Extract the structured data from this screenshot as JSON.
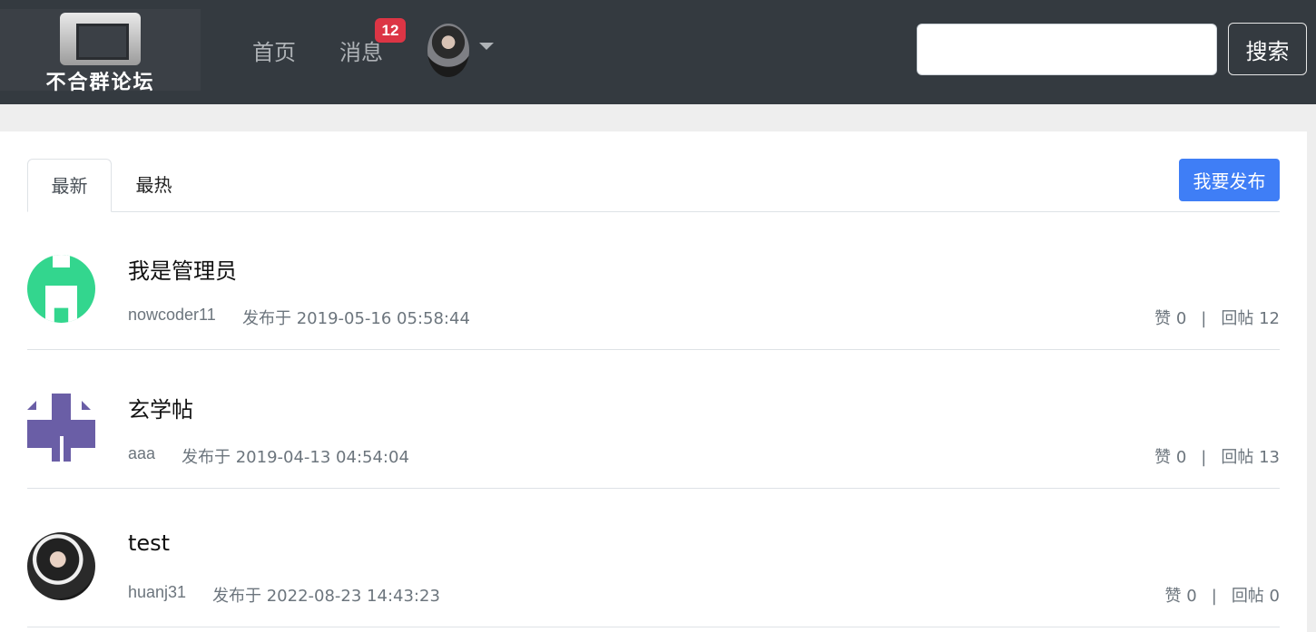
{
  "header": {
    "logo_text": "不合群论坛",
    "nav": {
      "home": "首页",
      "messages": "消息",
      "message_count": "12"
    },
    "search": {
      "value": "",
      "placeholder": "",
      "button": "搜索"
    }
  },
  "tabs": {
    "latest": "最新",
    "hottest": "最热"
  },
  "publish_button": "我要发布",
  "posts": [
    {
      "title": "我是管理员",
      "author": "nowcoder11",
      "time": "发布于 2019-05-16 05:58:44",
      "likes": "赞 0",
      "replies": "回帖 12",
      "avatar": "green-plug-icon"
    },
    {
      "title": "玄学帖",
      "author": "aaa",
      "time": "发布于 2019-04-13 04:54:04",
      "likes": "赞 0",
      "replies": "回帖 13",
      "avatar": "purple-pattern-icon"
    },
    {
      "title": "test",
      "author": "huanj31",
      "time": "发布于 2022-08-23 14:43:23",
      "likes": "赞 0",
      "replies": "回帖 0",
      "avatar": "user-photo"
    }
  ],
  "separator": "|"
}
